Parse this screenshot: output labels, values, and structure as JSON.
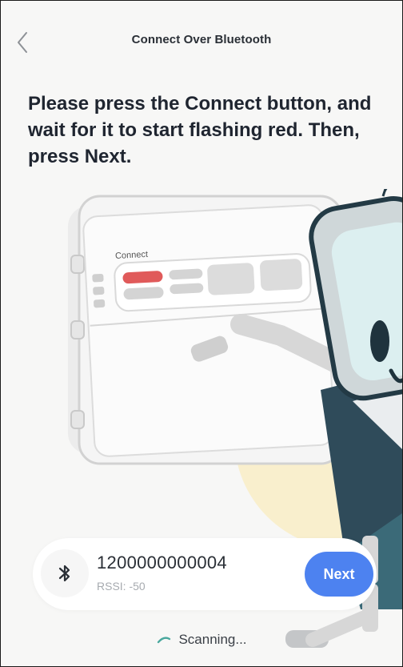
{
  "header": {
    "title": "Connect Over Bluetooth",
    "back_icon": "chevron-left-icon"
  },
  "instruction": "Please press the Connect button, and wait for it to start flashing red.  Then, press Next.",
  "illustration": {
    "panel_label": "Connect",
    "connect_indicator_color": "#e05a5a",
    "accent_color": "#3a7f88"
  },
  "device": {
    "icon": "bluetooth-icon",
    "id": "1200000000004",
    "rssi": "RSSI: -50",
    "next_label": "Next"
  },
  "status": {
    "text": "Scanning...",
    "icon": "spinner-icon"
  },
  "colors": {
    "primary_button": "#4d82f0",
    "background": "#f7f7f6",
    "text": "#1f2530"
  }
}
